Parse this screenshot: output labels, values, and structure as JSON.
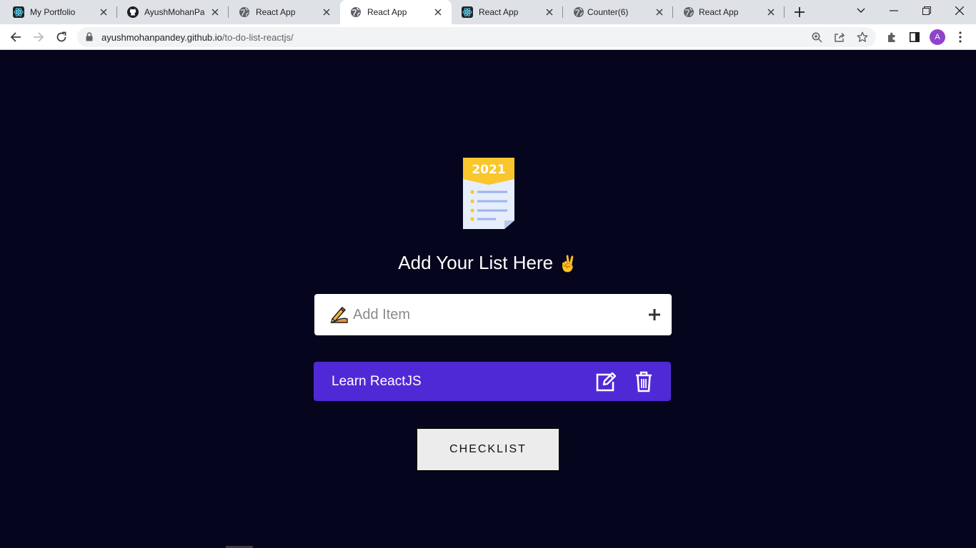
{
  "browser": {
    "tabs": [
      {
        "title": "My Portfolio",
        "favicon": "react-icon"
      },
      {
        "title": "AyushMohanPandey",
        "favicon": "github-icon"
      },
      {
        "title": "React App",
        "favicon": "globe-icon"
      },
      {
        "title": "React App",
        "favicon": "globe-icon",
        "active": true
      },
      {
        "title": "React App",
        "favicon": "react-icon"
      },
      {
        "title": "Counter(6)",
        "favicon": "globe-icon"
      },
      {
        "title": "React App",
        "favicon": "globe-icon"
      }
    ],
    "url_host": "ayushmohanpandey.github.io",
    "url_path": "/to-do-list-reactjs/",
    "avatar_letter": "A"
  },
  "app": {
    "badge_year": "2021",
    "heading": "Add Your List Here",
    "heading_emoji": "✌",
    "input_placeholder": "Add Item",
    "items": [
      "Learn ReactJS"
    ],
    "checklist_button": "CHECKLIST"
  },
  "colors": {
    "page_bg": "#05061e",
    "item_bg": "#5029d6",
    "badge": "#f9c72b"
  }
}
